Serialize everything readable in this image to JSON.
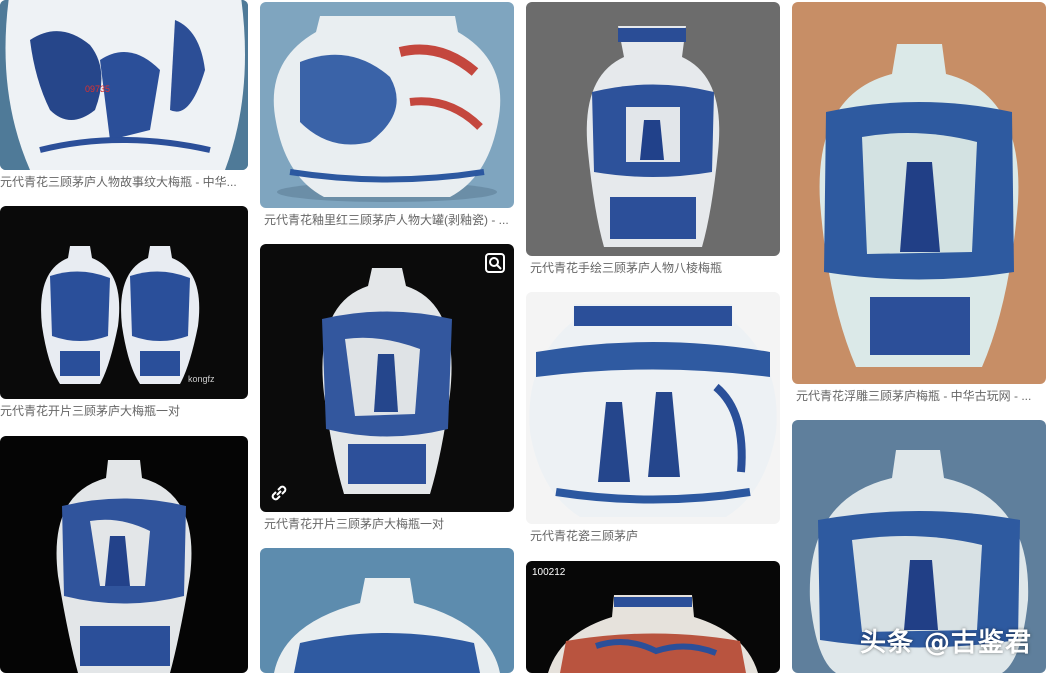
{
  "results": [
    {
      "caption": "元代青花三顾茅庐人物故事纹大梅瓶 - 中华..."
    },
    {
      "caption": "元代青花开片三顾茅庐大梅瓶一对"
    },
    {
      "caption": ""
    },
    {
      "caption": "元代青花釉里红三顾茅庐人物大罐(剥釉瓷) - ..."
    },
    {
      "caption": "元代青花开片三顾茅庐大梅瓶一对"
    },
    {
      "caption": ""
    },
    {
      "caption": "元代青花手绘三顾茅庐人物八棱梅瓶"
    },
    {
      "caption": "元代青花瓷三顾茅庐"
    },
    {
      "caption": "",
      "badge": "100212"
    },
    {
      "caption": "元代青花浮雕三顾茅庐梅瓶 - 中华古玩网 - ..."
    },
    {
      "caption": ""
    }
  ],
  "watermark": "头条 @古鉴君",
  "icons": {
    "visual_search": "visual-search-icon",
    "link": "link-icon"
  }
}
